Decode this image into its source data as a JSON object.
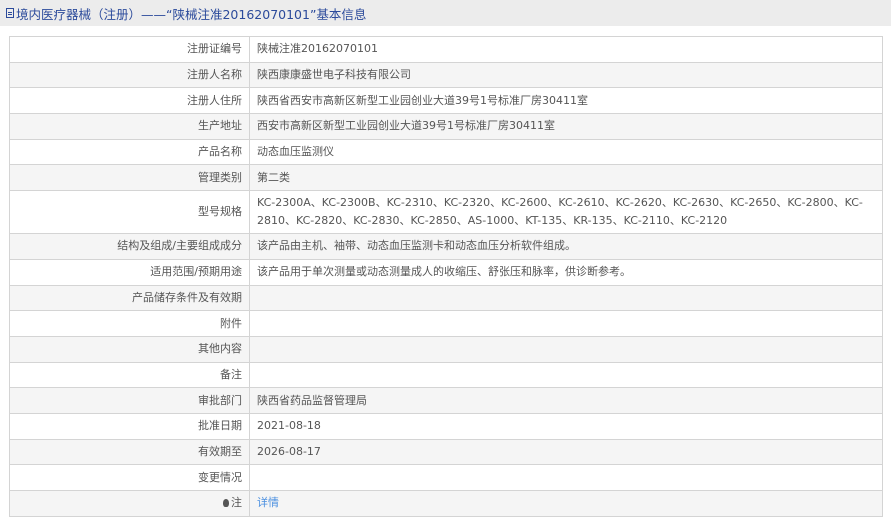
{
  "header": {
    "icon": "document-icon",
    "title": "境内医疗器械（注册）——“陕械注准20162070101”基本信息"
  },
  "rows": [
    {
      "label": "注册证编号",
      "value": "陕械注准20162070101"
    },
    {
      "label": "注册人名称",
      "value": "陕西康康盛世电子科技有限公司"
    },
    {
      "label": "注册人住所",
      "value": "陕西省西安市高新区新型工业园创业大道39号1号标准厂房30411室"
    },
    {
      "label": "生产地址",
      "value": "西安市高新区新型工业园创业大道39号1号标准厂房30411室"
    },
    {
      "label": "产品名称",
      "value": "动态血压监测仪"
    },
    {
      "label": "管理类别",
      "value": "第二类"
    },
    {
      "label": "型号规格",
      "value": "KC-2300A、KC-2300B、KC-2310、KC-2320、KC-2600、KC-2610、KC-2620、KC-2630、KC-2650、KC-2800、KC-2810、KC-2820、KC-2830、KC-2850、AS-1000、KT-135、KR-135、KC-2110、KC-2120"
    },
    {
      "label": "结构及组成/主要组成成分",
      "value": "该产品由主机、袖带、动态血压监测卡和动态血压分析软件组成。"
    },
    {
      "label": "适用范围/预期用途",
      "value": "该产品用于单次测量或动态测量成人的收缩压、舒张压和脉率，供诊断参考。"
    },
    {
      "label": "产品储存条件及有效期",
      "value": ""
    },
    {
      "label": "附件",
      "value": ""
    },
    {
      "label": "其他内容",
      "value": ""
    },
    {
      "label": "备注",
      "value": ""
    },
    {
      "label": "审批部门",
      "value": "陕西省药品监督管理局"
    },
    {
      "label": "批准日期",
      "value": "2021-08-18"
    },
    {
      "label": "有效期至",
      "value": "2026-08-17"
    },
    {
      "label": "变更情况",
      "value": ""
    }
  ],
  "note": {
    "icon": "lightbulb-icon",
    "label": "注",
    "link": "详情"
  }
}
